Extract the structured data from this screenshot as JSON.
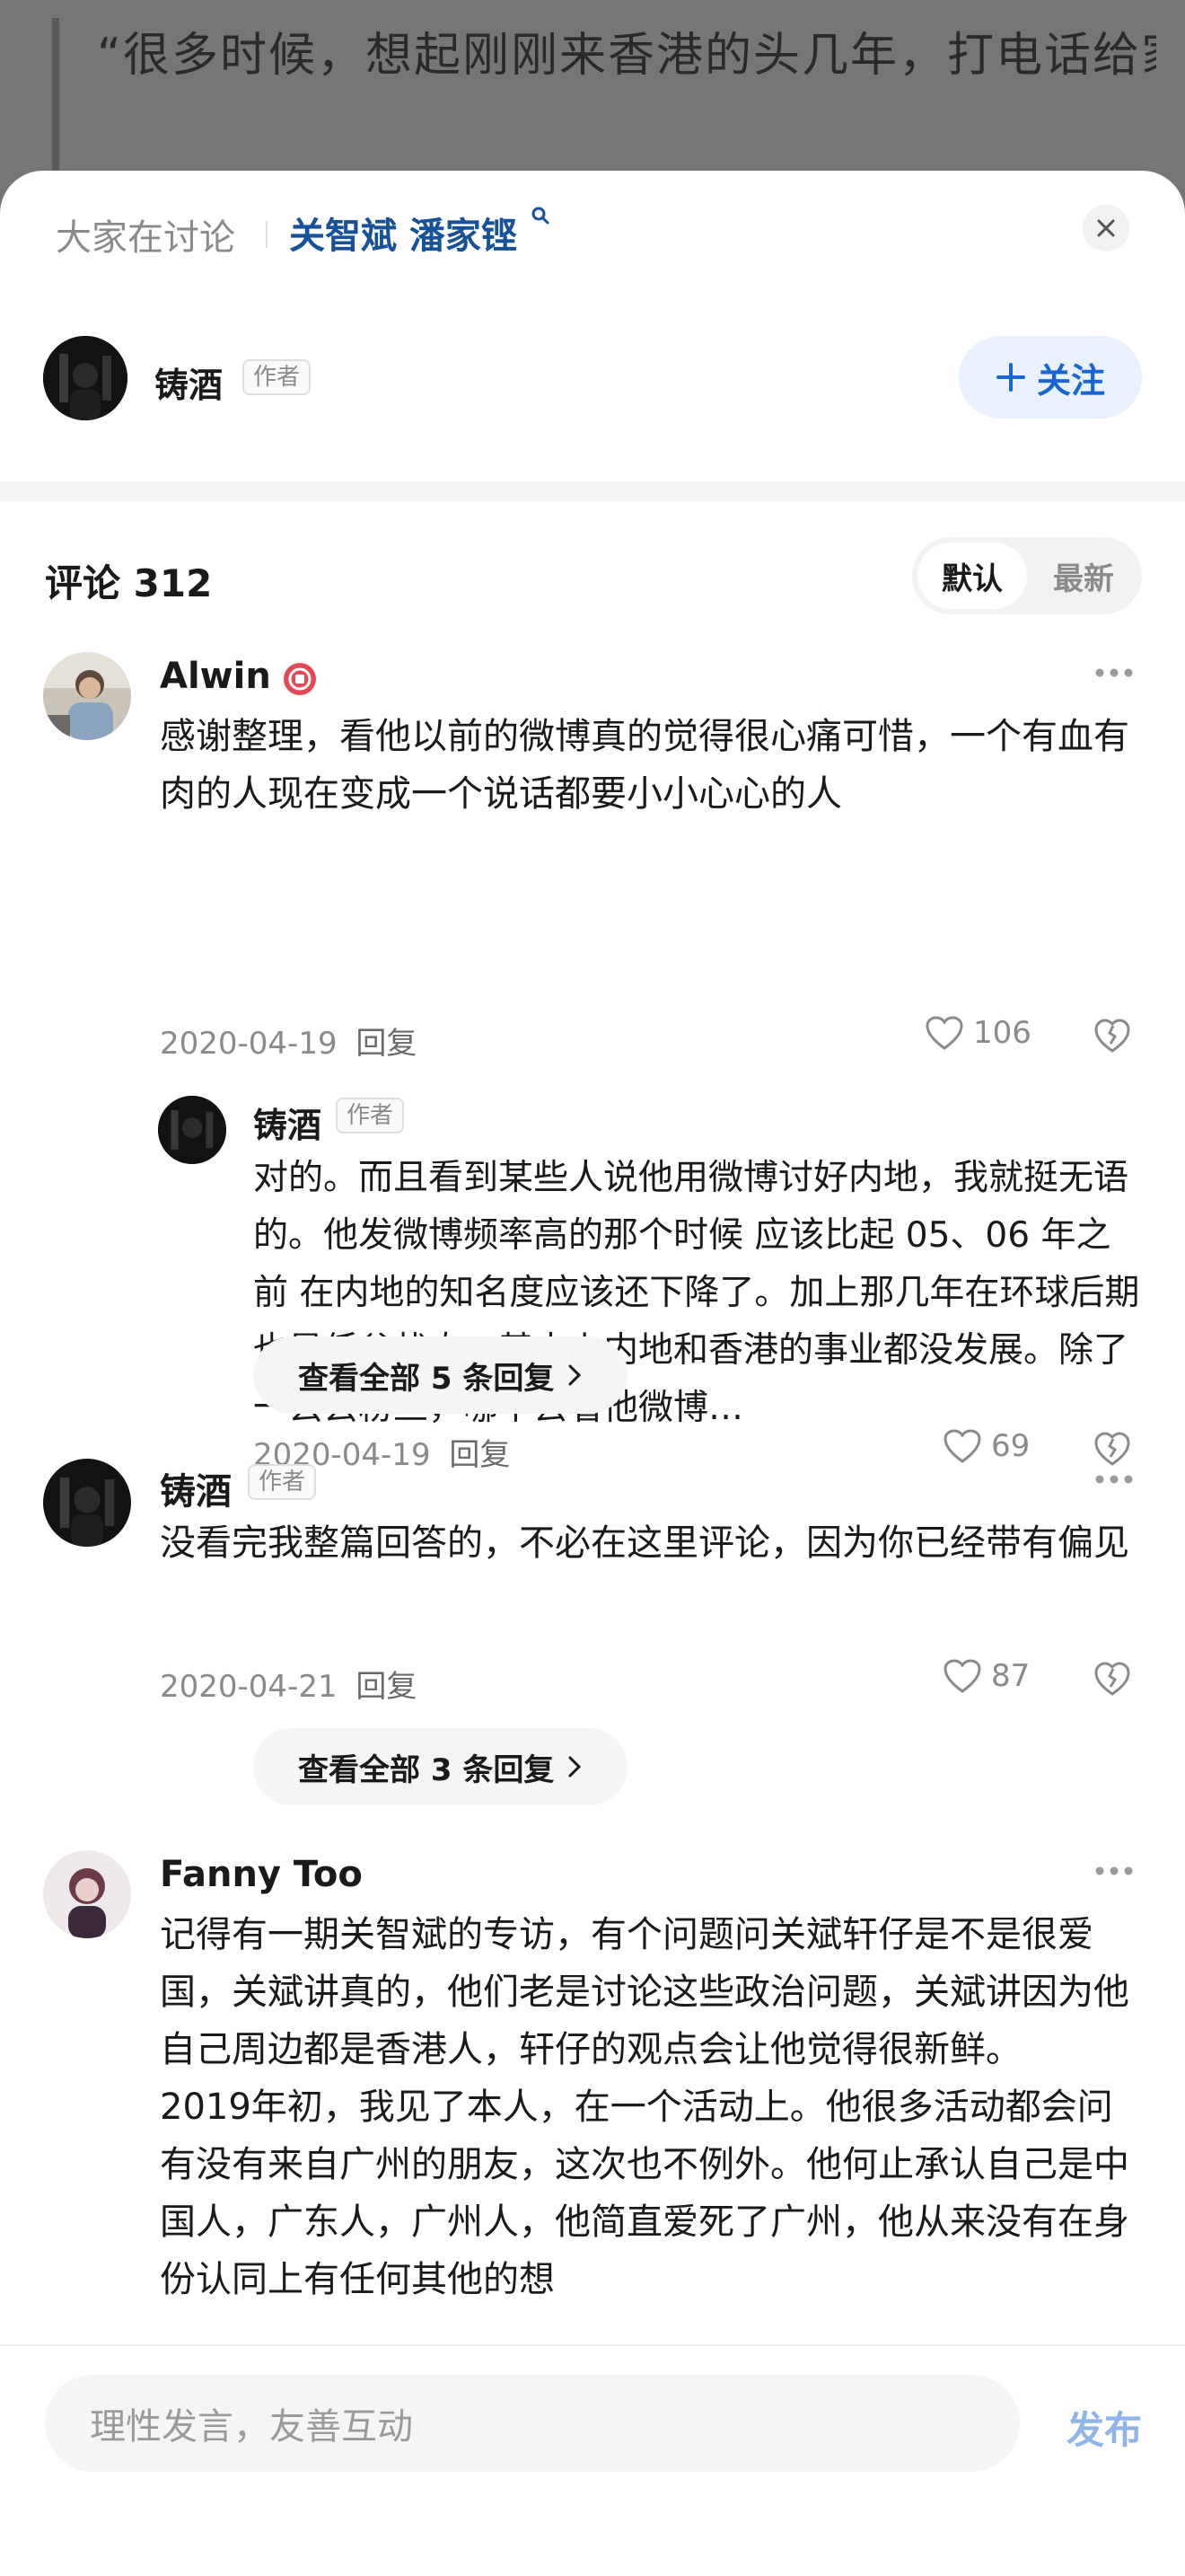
{
  "background_article": {
    "quote_lines": "“很多时候，想起刚刚来香港的头几年，打电话给家，给爸爸妈妈的时候，爸爸妈妈都会"
  },
  "sheet": {
    "discuss_label": "大家在讨论",
    "topics": "关智斌 潘家铿"
  },
  "author": {
    "name": "铸酒",
    "badge": "作者",
    "follow_label": "关注"
  },
  "comments_header": {
    "title": "评论 312",
    "sort_default": "默认",
    "sort_latest": "最新"
  },
  "comments": [
    {
      "name": "Alwin",
      "text": "感谢整理，看他以前的微博真的觉得很心痛可惜，一个有血有肉的人现在变成一个说话都要小小心心的人",
      "date": "2020-04-19",
      "reply": "回复",
      "likes": "106"
    },
    {
      "name": "铸酒",
      "badge": "作者",
      "text": "没看完我整篇回答的，不必在这里评论，因为你已经带有偏见",
      "date": "2020-04-21",
      "reply": "回复",
      "likes": "87",
      "view_all": "查看全部 3 条回复"
    },
    {
      "name": "Fanny Too",
      "text": "记得有一期关智斌的专访，有个问题问关斌轩仔是不是很爱国，关斌讲真的，他们老是讨论这些政治问题，关斌讲因为他自己周边都是香港人，轩仔的观点会让他觉得很新鲜。\n2019年初，我见了本人，在一个活动上。他很多活动都会问有没有来自广州的朋友，这次也不例外。他何止承认自己是中国人，广东人，广州人，他简直爱死了广州，他从来没有在身份认同上有任何其他的想"
    }
  ],
  "sub_reply": {
    "name": "铸酒",
    "badge": "作者",
    "text": "对的。而且看到某些人说他用微博讨好内地，我就挺无语的。他发微博频率高的那个时候 应该比起 05、06 年之前 在内地的知名度应该还下降了。加上那几年在环球后期也是低谷状态，基本上内地和香港的事业都没发展。除了一丢丢粉丝，哪个去看他微博…",
    "date": "2020-04-19",
    "reply": "回复",
    "likes": "69",
    "view_all": "查看全部 5 条回复"
  },
  "composer": {
    "placeholder": "理性发言，友善互动",
    "publish_label": "发布"
  }
}
